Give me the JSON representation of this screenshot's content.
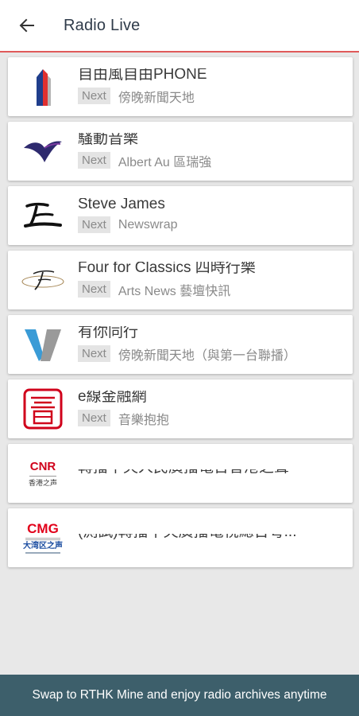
{
  "header": {
    "title": "Radio Live",
    "back_icon": "arrow-left-icon"
  },
  "next_label": "Next",
  "channels": [
    {
      "logo": "radio-1-logo",
      "now": "自由風自由PHONE",
      "next": "傍晚新聞天地"
    },
    {
      "logo": "radio-2-logo",
      "now": "騷動音樂",
      "next": "Albert Au 區瑞強"
    },
    {
      "logo": "radio-3-logo",
      "now": "Steve James",
      "next": "Newswrap"
    },
    {
      "logo": "radio-4-logo",
      "now": "Four for Classics 四時行樂",
      "next": "Arts News 藝壇快訊"
    },
    {
      "logo": "radio-5-logo",
      "now": "有你同行",
      "next": "傍晚新聞天地（與第一台聯播）"
    },
    {
      "logo": "putonghua-logo",
      "now": "e線金融網",
      "next": "音樂抱抱"
    },
    {
      "logo": "cnr-logo",
      "now": "轉播中央人民廣播電台香港之聲",
      "next": ""
    },
    {
      "logo": "cmg-logo",
      "now": "(測試)轉播中央廣播電視總台粵...",
      "next": ""
    }
  ],
  "logo_text": {
    "cnr": "CNR",
    "cnr_sub": "香港之声",
    "cmg": "CMG",
    "cmg_sub": "大湾区之声"
  },
  "footer": {
    "text": "Swap to RTHK Mine and enjoy radio archives anytime"
  },
  "colors": {
    "footer_bg": "#3d5f6b",
    "header_underline": "#e05a5a",
    "cnr_red": "#d0021b",
    "cmg_red": "#e2001a",
    "cmg_blue": "#1a4ca0"
  }
}
